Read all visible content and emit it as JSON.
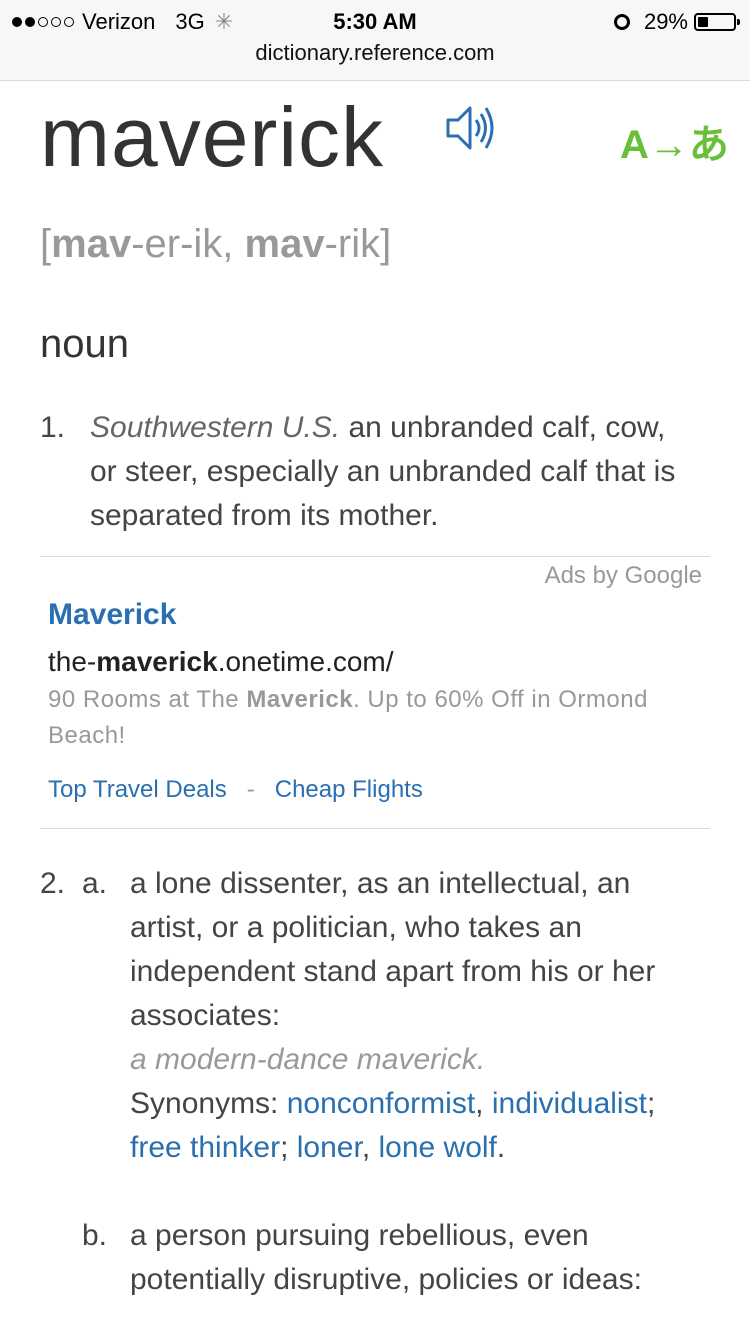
{
  "status": {
    "carrier": "Verizon",
    "network": "3G",
    "time": "5:30 AM",
    "battery": "29%",
    "battery_level": 0.29,
    "signal_bars": 2,
    "url": "dictionary.reference.com"
  },
  "entry": {
    "word": "maverick",
    "pron_open": "[",
    "pron_1_bold": "mav",
    "pron_1_rest": "-er-ik, ",
    "pron_2_bold": "mav",
    "pron_2_rest": "-rik",
    "pron_close": "]",
    "translate_label": "A→あ",
    "part_of_speech": "noun"
  },
  "def1": {
    "number": "1.",
    "region": "Southwestern U.S.",
    "text": " an unbranded calf, cow, or steer, especially an unbranded calf that is separated from its mother."
  },
  "ad": {
    "ads_by": "Ads by Google",
    "title": "Maverick",
    "url_pre": "the-",
    "url_bold": "maverick",
    "url_post": ".onetime.com/",
    "desc_pre": "90 Rooms at The ",
    "desc_bold": "Maverick",
    "desc_post": ". Up to 60% Off in Ormond Beach!",
    "link1": "Top Travel Deals",
    "separator": "-",
    "link2": "Cheap Flights"
  },
  "def2": {
    "number": "2.",
    "a_label": "a.",
    "a_text": "a lone dissenter, as an intellectual, an artist, or a politician, who takes an independent stand apart from his or her associates:",
    "example": "a modern-dance maverick.",
    "synonyms_label": "Synonyms: ",
    "syn1": "nonconformist",
    "syn2": "individualist",
    "syn3": "free thinker",
    "syn4": "loner",
    "syn5": "lone wolf",
    "b_label": "b.",
    "b_text": "a person pursuing rebellious, even potentially disruptive, policies or ideas:"
  },
  "colors": {
    "link": "#2a6fb0",
    "translate": "#6abf3a",
    "muted": "#999999"
  }
}
